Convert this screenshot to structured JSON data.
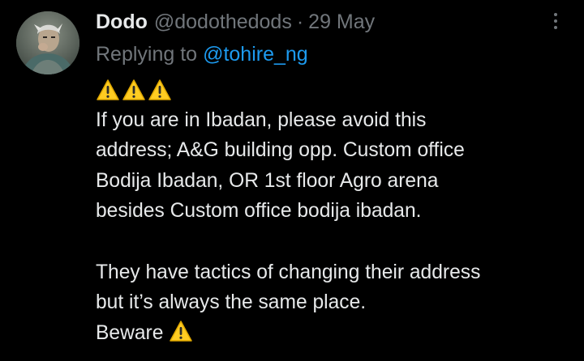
{
  "tweet": {
    "author_name": "Dodo",
    "author_handle": "@dodothedods",
    "separator": "·",
    "date": "29 May",
    "reply_prefix": "Replying to",
    "reply_to": "@tohire_ng",
    "lines": [
      "If you are in Ibadan, please avoid this",
      "address; A&G building opp. Custom office",
      "Bodija Ibadan, OR 1st floor Agro arena",
      "besides Custom office bodija ibadan.",
      "They have tactics of changing their address",
      "but it’s always the same place.",
      "Beware"
    ],
    "warning_emoji_name": "warning-icon",
    "more_icon_name": "more-options-icon"
  },
  "colors": {
    "background": "#000000",
    "primary_text": "#e7e9ea",
    "secondary_text": "#71767b",
    "link": "#1d9bf0",
    "warning_yellow": "#ffcc22"
  }
}
